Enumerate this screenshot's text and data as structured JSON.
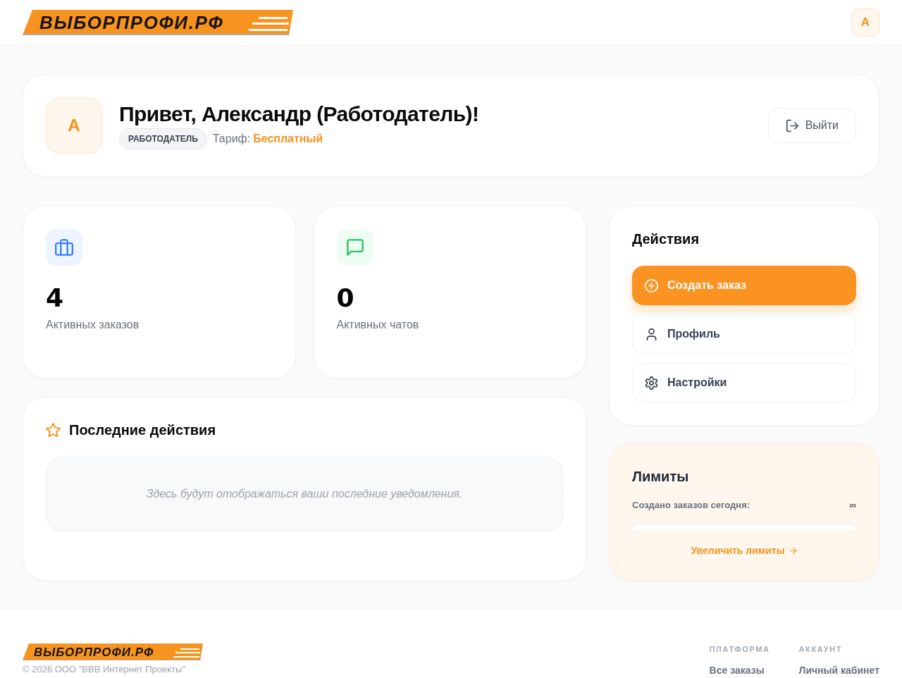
{
  "header": {
    "logo": "ВЫБОРПРОФИ.РФ",
    "user_avatar": "А"
  },
  "welcome": {
    "avatar": "А",
    "greeting": "Привет, Александр (Работодатель)!",
    "role_badge": "РАБОТОДАТЕЛЬ",
    "plan_label": "Тариф:",
    "plan": "Бесплатный",
    "logout_button": "Выйти"
  },
  "stats": [
    {
      "kind": "orders",
      "value": "4",
      "label": "Активных заказов"
    },
    {
      "kind": "chats",
      "value": "0",
      "label": "Активных чатов"
    }
  ],
  "recent": {
    "title": "Последние действия",
    "empty_text": "Здесь будут отображаться ваши последние уведомления."
  },
  "actions": {
    "title": "Действия",
    "buttons": [
      {
        "kind": "create",
        "primary": true,
        "label": "Создать заказ"
      },
      {
        "kind": "profile",
        "primary": false,
        "label": "Профиль"
      },
      {
        "kind": "settings",
        "primary": false,
        "label": "Настройки"
      }
    ]
  },
  "limits": {
    "title": "Лимиты",
    "label": "Создано заказов сегодня:",
    "reading": "∞",
    "level": 0,
    "link": "Увеличить лимиты"
  },
  "footer": {
    "logo": "ВЫБОРПРОФИ.РФ",
    "copyright": "© 2026 ООО \"ВВВ Интернет Проекты\"",
    "columns": [
      {
        "heading": "ПЛАТФОРМА",
        "links": [
          "Все заказы"
        ]
      },
      {
        "heading": "АККАУНТ",
        "links": [
          "Личный кабинет"
        ]
      }
    ]
  }
}
